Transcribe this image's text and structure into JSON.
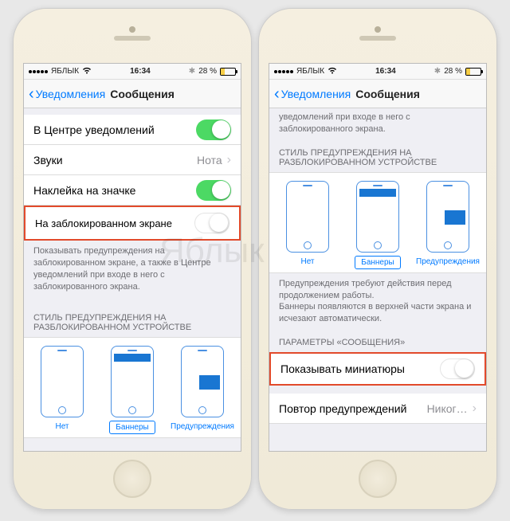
{
  "watermark": "Яблык",
  "status": {
    "carrier": "ЯБЛЫК",
    "time": "16:34",
    "battery_pct": "28 %",
    "bt_icon": "✱"
  },
  "nav": {
    "back": "Уведомления",
    "title": "Сообщения"
  },
  "left": {
    "rows": {
      "in_nc": "В Центре уведомлений",
      "sounds": "Звуки",
      "sounds_val": "Нота",
      "badge": "Наклейка на значке",
      "lockscreen": "На заблокированном экране"
    },
    "footer1": "Показывать предупреждения на заблокированном экране, а также в Центре уведомлений при входе в него с заблокированного экрана.",
    "styles_header": "СТИЛЬ ПРЕДУПРЕЖДЕНИЯ НА РАЗБЛОКИРОВАННОМ УСТРОЙСТВЕ",
    "styles": {
      "none": "Нет",
      "banners": "Баннеры",
      "alerts": "Предупреждения"
    }
  },
  "right": {
    "top_footer": "уведомлений при входе в него с заблокированного экрана.",
    "styles_header": "СТИЛЬ ПРЕДУПРЕЖДЕНИЯ НА РАЗБЛОКИРОВАННОМ УСТРОЙСТВЕ",
    "styles": {
      "none": "Нет",
      "banners": "Баннеры",
      "alerts": "Предупреждения"
    },
    "footer2": "Предупреждения требуют действия перед продолжением работы.\nБаннеры появляются в верхней части экрана и исчезают автоматически.",
    "params_header": "ПАРАМЕТРЫ «СООБЩЕНИЯ»",
    "show_previews": "Показывать миниатюры",
    "repeat": "Повтор предупреждений",
    "repeat_val": "Никог…"
  }
}
